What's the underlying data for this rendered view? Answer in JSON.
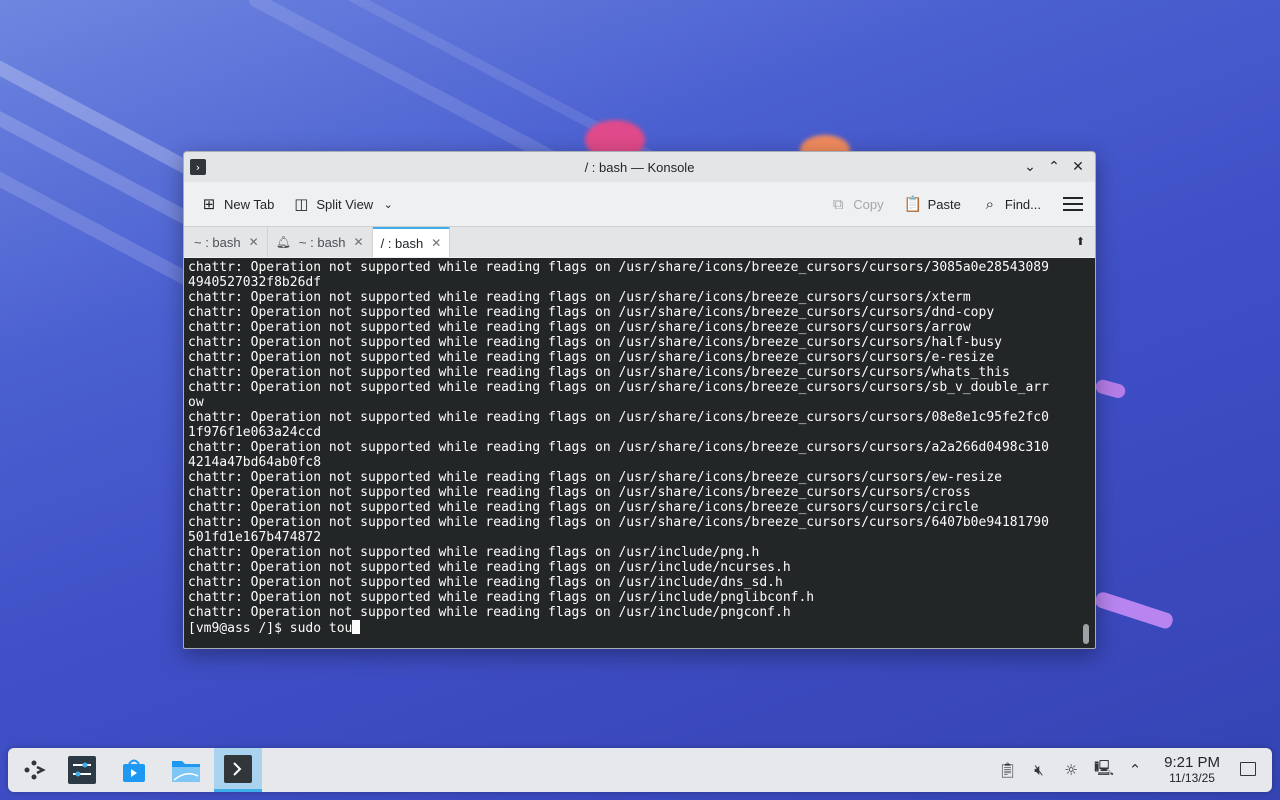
{
  "window": {
    "title": "/ : bash — Konsole",
    "controls": [
      "minimize",
      "maximize",
      "close"
    ]
  },
  "toolbar": {
    "new_tab": "New Tab",
    "split_view": "Split View",
    "copy": "Copy",
    "paste": "Paste",
    "find": "Find..."
  },
  "tabs": [
    {
      "label": "~ : bash",
      "active": false
    },
    {
      "label": "~ : bash",
      "active": false,
      "bell": true
    },
    {
      "label": "/ : bash",
      "active": true
    }
  ],
  "terminal": {
    "lines": [
      "chattr: Operation not supported while reading flags on /usr/share/icons/breeze_cursors/cursors/3085a0e28543089",
      "4940527032f8b26df",
      "chattr: Operation not supported while reading flags on /usr/share/icons/breeze_cursors/cursors/xterm",
      "chattr: Operation not supported while reading flags on /usr/share/icons/breeze_cursors/cursors/dnd-copy",
      "chattr: Operation not supported while reading flags on /usr/share/icons/breeze_cursors/cursors/arrow",
      "chattr: Operation not supported while reading flags on /usr/share/icons/breeze_cursors/cursors/half-busy",
      "chattr: Operation not supported while reading flags on /usr/share/icons/breeze_cursors/cursors/e-resize",
      "chattr: Operation not supported while reading flags on /usr/share/icons/breeze_cursors/cursors/whats_this",
      "chattr: Operation not supported while reading flags on /usr/share/icons/breeze_cursors/cursors/sb_v_double_arr",
      "ow",
      "chattr: Operation not supported while reading flags on /usr/share/icons/breeze_cursors/cursors/08e8e1c95fe2fc0",
      "1f976f1e063a24ccd",
      "chattr: Operation not supported while reading flags on /usr/share/icons/breeze_cursors/cursors/a2a266d0498c310",
      "4214a47bd64ab0fc8",
      "chattr: Operation not supported while reading flags on /usr/share/icons/breeze_cursors/cursors/ew-resize",
      "chattr: Operation not supported while reading flags on /usr/share/icons/breeze_cursors/cursors/cross",
      "chattr: Operation not supported while reading flags on /usr/share/icons/breeze_cursors/cursors/circle",
      "chattr: Operation not supported while reading flags on /usr/share/icons/breeze_cursors/cursors/6407b0e94181790",
      "501fd1e167b474872",
      "chattr: Operation not supported while reading flags on /usr/include/png.h",
      "chattr: Operation not supported while reading flags on /usr/include/ncurses.h",
      "chattr: Operation not supported while reading flags on /usr/include/dns_sd.h",
      "chattr: Operation not supported while reading flags on /usr/include/pnglibconf.h",
      "chattr: Operation not supported while reading flags on /usr/include/pngconf.h"
    ],
    "prompt": "[vm9@ass /]$ ",
    "input": "sudo tou"
  },
  "taskbar": {
    "tasks": [
      {
        "name": "application-launcher",
        "icon": "kde-launcher-icon"
      },
      {
        "name": "system-settings",
        "icon": "settings-sliders-icon"
      },
      {
        "name": "discover",
        "icon": "store-bag-icon"
      },
      {
        "name": "dolphin",
        "icon": "folder-icon"
      },
      {
        "name": "konsole",
        "icon": "terminal-icon",
        "active": true
      }
    ],
    "clock": {
      "time": "9:21 PM",
      "date": "11/13/25"
    }
  },
  "colors": {
    "accent": "#3daee9",
    "terminal_bg": "#232627",
    "terminal_fg": "#fcfcfc"
  }
}
